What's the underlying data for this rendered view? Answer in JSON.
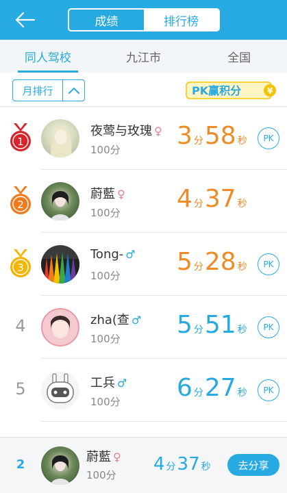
{
  "header": {
    "segments": [
      "成绩",
      "排行榜"
    ],
    "active_segment": 1
  },
  "tabs": [
    {
      "label": "同人驾校",
      "active": true
    },
    {
      "label": "九江市",
      "active": false
    },
    {
      "label": "全国",
      "active": false
    }
  ],
  "filter": {
    "period_label": "月排行",
    "pk_banner": "PK赢积分"
  },
  "colors": {
    "primary": "#27a9e1",
    "orange_time": "#f08a24",
    "blue_time": "#27a9e1",
    "medal_gold": "#f5b400",
    "medal_silver": "#f07a1c",
    "medal_red": "#d9232a",
    "female": "#e87f8e"
  },
  "ranking": [
    {
      "rank": "1",
      "name": "夜莺与玫瑰",
      "gender": "♀",
      "score": "100分",
      "min": "3",
      "min_unit": "分",
      "sec": "58",
      "sec_unit": "秒",
      "pk": "PK"
    },
    {
      "rank": "2",
      "name": "蔚藍",
      "gender": "♀",
      "score": "100分",
      "min": "4",
      "min_unit": "分",
      "sec": "37",
      "sec_unit": "秒",
      "pk": ""
    },
    {
      "rank": "3",
      "name": "Tong-",
      "gender": "♂",
      "score": "100分",
      "min": "5",
      "min_unit": "分",
      "sec": "28",
      "sec_unit": "秒",
      "pk": "PK"
    },
    {
      "rank": "4",
      "name": "zha(查",
      "gender": "♂",
      "score": "100分",
      "min": "5",
      "min_unit": "分",
      "sec": "51",
      "sec_unit": "秒",
      "pk": "PK"
    },
    {
      "rank": "5",
      "name": "工兵",
      "gender": "♂",
      "score": "100分",
      "min": "6",
      "min_unit": "分",
      "sec": "27",
      "sec_unit": "秒",
      "pk": "PK"
    }
  ],
  "footer": {
    "rank": "2",
    "name": "蔚藍",
    "gender": "♀",
    "score": "100分",
    "min": "4",
    "min_unit": "分",
    "sec": "37",
    "sec_unit": "秒",
    "share_label": "去分享"
  }
}
